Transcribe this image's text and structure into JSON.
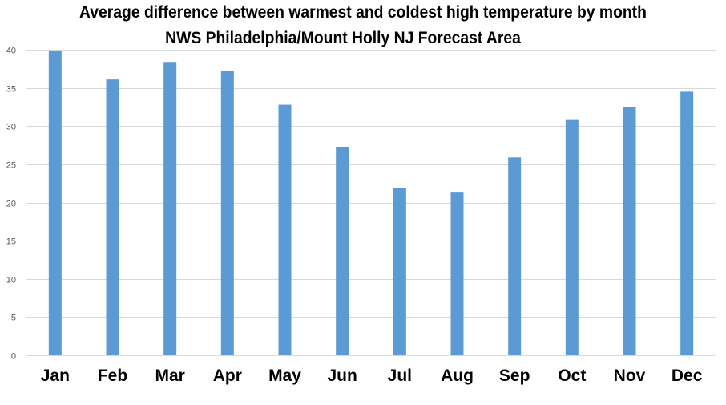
{
  "chart_data": {
    "type": "bar",
    "title": "Average difference between warmest and coldest high temperature by month",
    "subtitle": "NWS Philadelphia/Mount Holly NJ Forecast Area",
    "xlabel": "",
    "ylabel": "",
    "categories": [
      "Jan",
      "Feb",
      "Mar",
      "Apr",
      "May",
      "Jun",
      "Jul",
      "Aug",
      "Sep",
      "Oct",
      "Nov",
      "Dec"
    ],
    "values": [
      39.9,
      36.1,
      38.4,
      37.2,
      32.8,
      27.3,
      21.9,
      21.3,
      25.9,
      30.8,
      32.5,
      34.5
    ],
    "ylim": [
      0,
      40
    ],
    "yticks": [
      0,
      5,
      10,
      15,
      20,
      25,
      30,
      35,
      40
    ],
    "grid": true,
    "legend": "none",
    "bar_color": "#5B9BD5",
    "grid_color": "#D9D9D9"
  }
}
